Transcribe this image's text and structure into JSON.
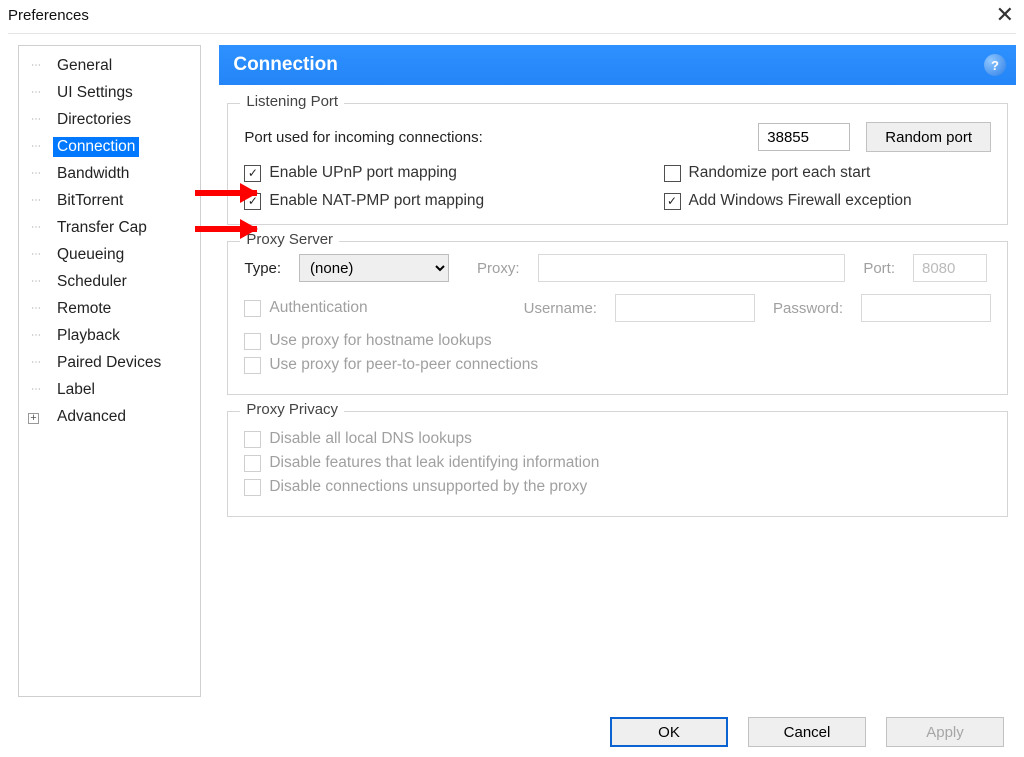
{
  "window": {
    "title": "Preferences",
    "close": "✕"
  },
  "sidebar": {
    "items": [
      {
        "label": "General"
      },
      {
        "label": "UI Settings"
      },
      {
        "label": "Directories"
      },
      {
        "label": "Connection",
        "selected": true
      },
      {
        "label": "Bandwidth"
      },
      {
        "label": "BitTorrent"
      },
      {
        "label": "Transfer Cap"
      },
      {
        "label": "Queueing"
      },
      {
        "label": "Scheduler"
      },
      {
        "label": "Remote"
      },
      {
        "label": "Playback"
      },
      {
        "label": "Paired Devices"
      },
      {
        "label": "Label"
      },
      {
        "label": "Advanced",
        "expander": true
      }
    ]
  },
  "panel": {
    "title": "Connection",
    "help": "?"
  },
  "listening": {
    "legend": "Listening Port",
    "label_port": "Port used for incoming connections:",
    "port": "38855",
    "random_btn": "Random port",
    "upnp": "Enable UPnP port mapping",
    "natpmp": "Enable NAT-PMP port mapping",
    "randomize": "Randomize port each start",
    "firewall": "Add Windows Firewall exception",
    "checked": {
      "upnp": true,
      "natpmp": true,
      "randomize": false,
      "firewall": true
    }
  },
  "proxy": {
    "legend": "Proxy Server",
    "type_label": "Type:",
    "type_value": "(none)",
    "proxy_label": "Proxy:",
    "proxy_value": "",
    "port_label": "Port:",
    "port_value": "8080",
    "auth": "Authentication",
    "user_label": "Username:",
    "pass_label": "Password:",
    "hostlookup": "Use proxy for hostname lookups",
    "p2p": "Use proxy for peer-to-peer connections"
  },
  "privacy": {
    "legend": "Proxy Privacy",
    "dns": "Disable all local DNS lookups",
    "leak": "Disable features that leak identifying information",
    "unsupported": "Disable connections unsupported by the proxy"
  },
  "footer": {
    "ok": "OK",
    "cancel": "Cancel",
    "apply": "Apply"
  }
}
